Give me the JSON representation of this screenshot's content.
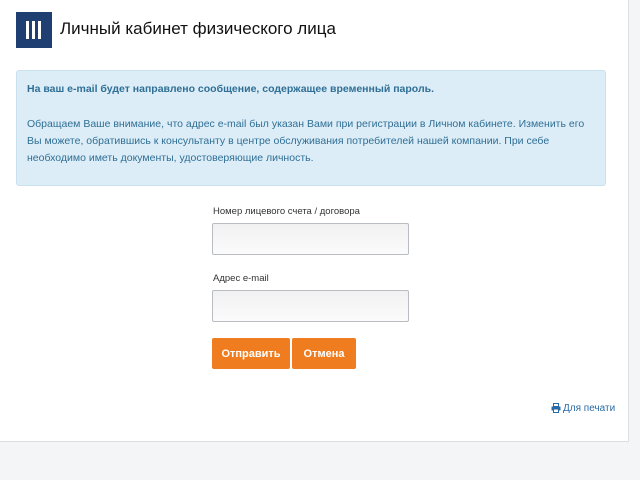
{
  "header": {
    "title": "Личный кабинет физического лица"
  },
  "info": {
    "lead": "На ваш e-mail будет направлено сообщение, содержащее временный пароль.",
    "text": "Обращаем Ваше внимание, что адрес e-mail был указан Вами при регистрации в Личном кабинете. Изменить его Вы можете, обратившись к консультанту в центре обслуживания потребителей нашей компании. При себе необходимо иметь документы, удостоверяющие личность."
  },
  "form": {
    "account_label": "Номер лицевого счета / договора",
    "account_value": "",
    "email_label": "Адрес e-mail",
    "email_value": "",
    "submit_label": "Отправить",
    "cancel_label": "Отмена"
  },
  "footer": {
    "print_label": "Для печати",
    "print_icon": "print-icon"
  },
  "colors": {
    "brand": "#1f3f73",
    "accent": "#ef7d1f",
    "info_background": "#dcedf7",
    "info_text": "#2f6f95",
    "link": "#2a6aa5"
  }
}
